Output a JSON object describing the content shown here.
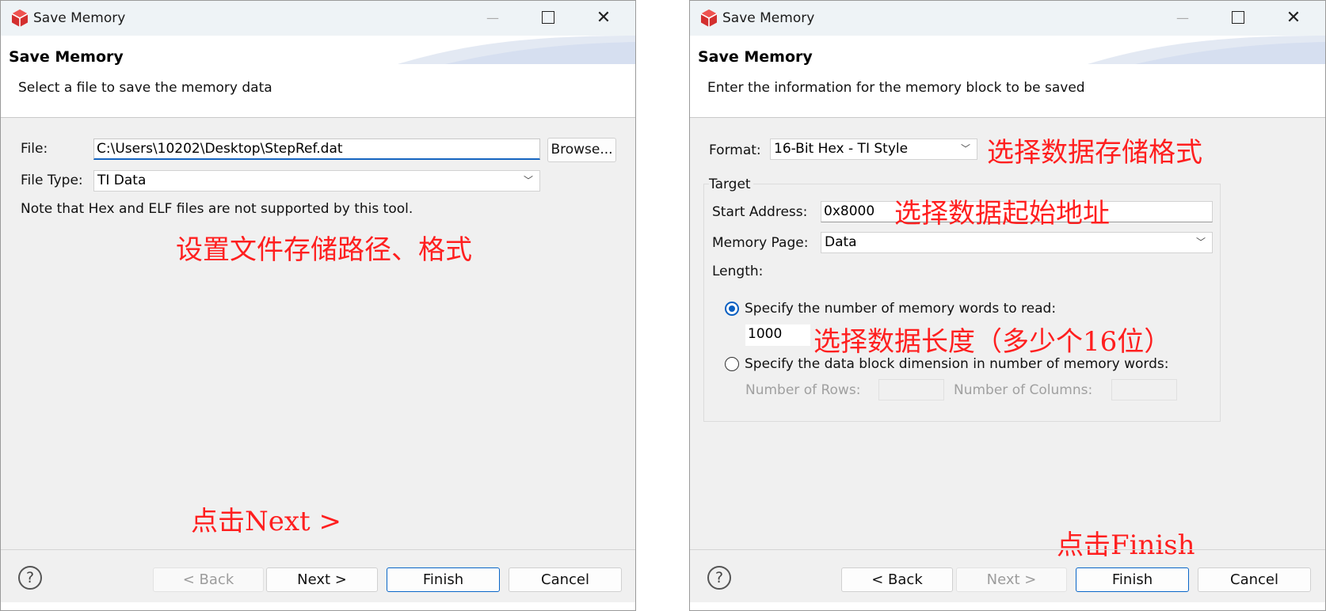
{
  "left_dialog": {
    "window_title": "Save Memory",
    "header_title": "Save Memory",
    "header_subtitle": "Select a file to save the memory data",
    "file_label": "File:",
    "file_value": "C:\\Users\\10202\\Desktop\\StepRef.dat",
    "browse_label": "Browse...",
    "file_type_label": "File Type:",
    "file_type_value": "TI Data",
    "note": "Note that Hex and ELF files are not supported by this tool.",
    "annotation_path": "设置文件存储路径、格式",
    "annotation_next": "点击Next >",
    "buttons": {
      "back": "< Back",
      "next": "Next >",
      "finish": "Finish",
      "cancel": "Cancel"
    }
  },
  "right_dialog": {
    "window_title": "Save Memory",
    "header_title": "Save Memory",
    "header_subtitle": "Enter the information for the memory block to be saved",
    "format_label": "Format:",
    "format_value": "16-Bit Hex - TI Style",
    "annotation_format": "选择数据存储格式",
    "group_label": "Target",
    "start_address_label": "Start Address:",
    "start_address_value": "0x8000",
    "annotation_address": "选择数据起始地址",
    "memory_page_label": "Memory Page:",
    "memory_page_value": "Data",
    "length_label": "Length:",
    "radio_words_label": "Specify the number of memory words to read:",
    "words_value": "1000",
    "annotation_length": "选择数据长度（多少个16位）",
    "radio_block_label": "Specify the data block dimension in number of memory words:",
    "rows_label": "Number of Rows:",
    "columns_label": "Number of Columns:",
    "annotation_finish": "点击Finish",
    "buttons": {
      "back": "< Back",
      "next": "Next >",
      "finish": "Finish",
      "cancel": "Cancel"
    }
  },
  "colors": {
    "annotation": "#ff1f1f",
    "accent": "#0a66c8",
    "app_icon": "#d32f2f"
  },
  "icons": {
    "app": "app-cube-icon",
    "help": "help-icon",
    "minimize": "minimize-icon",
    "maximize": "maximize-icon",
    "close": "close-icon"
  }
}
